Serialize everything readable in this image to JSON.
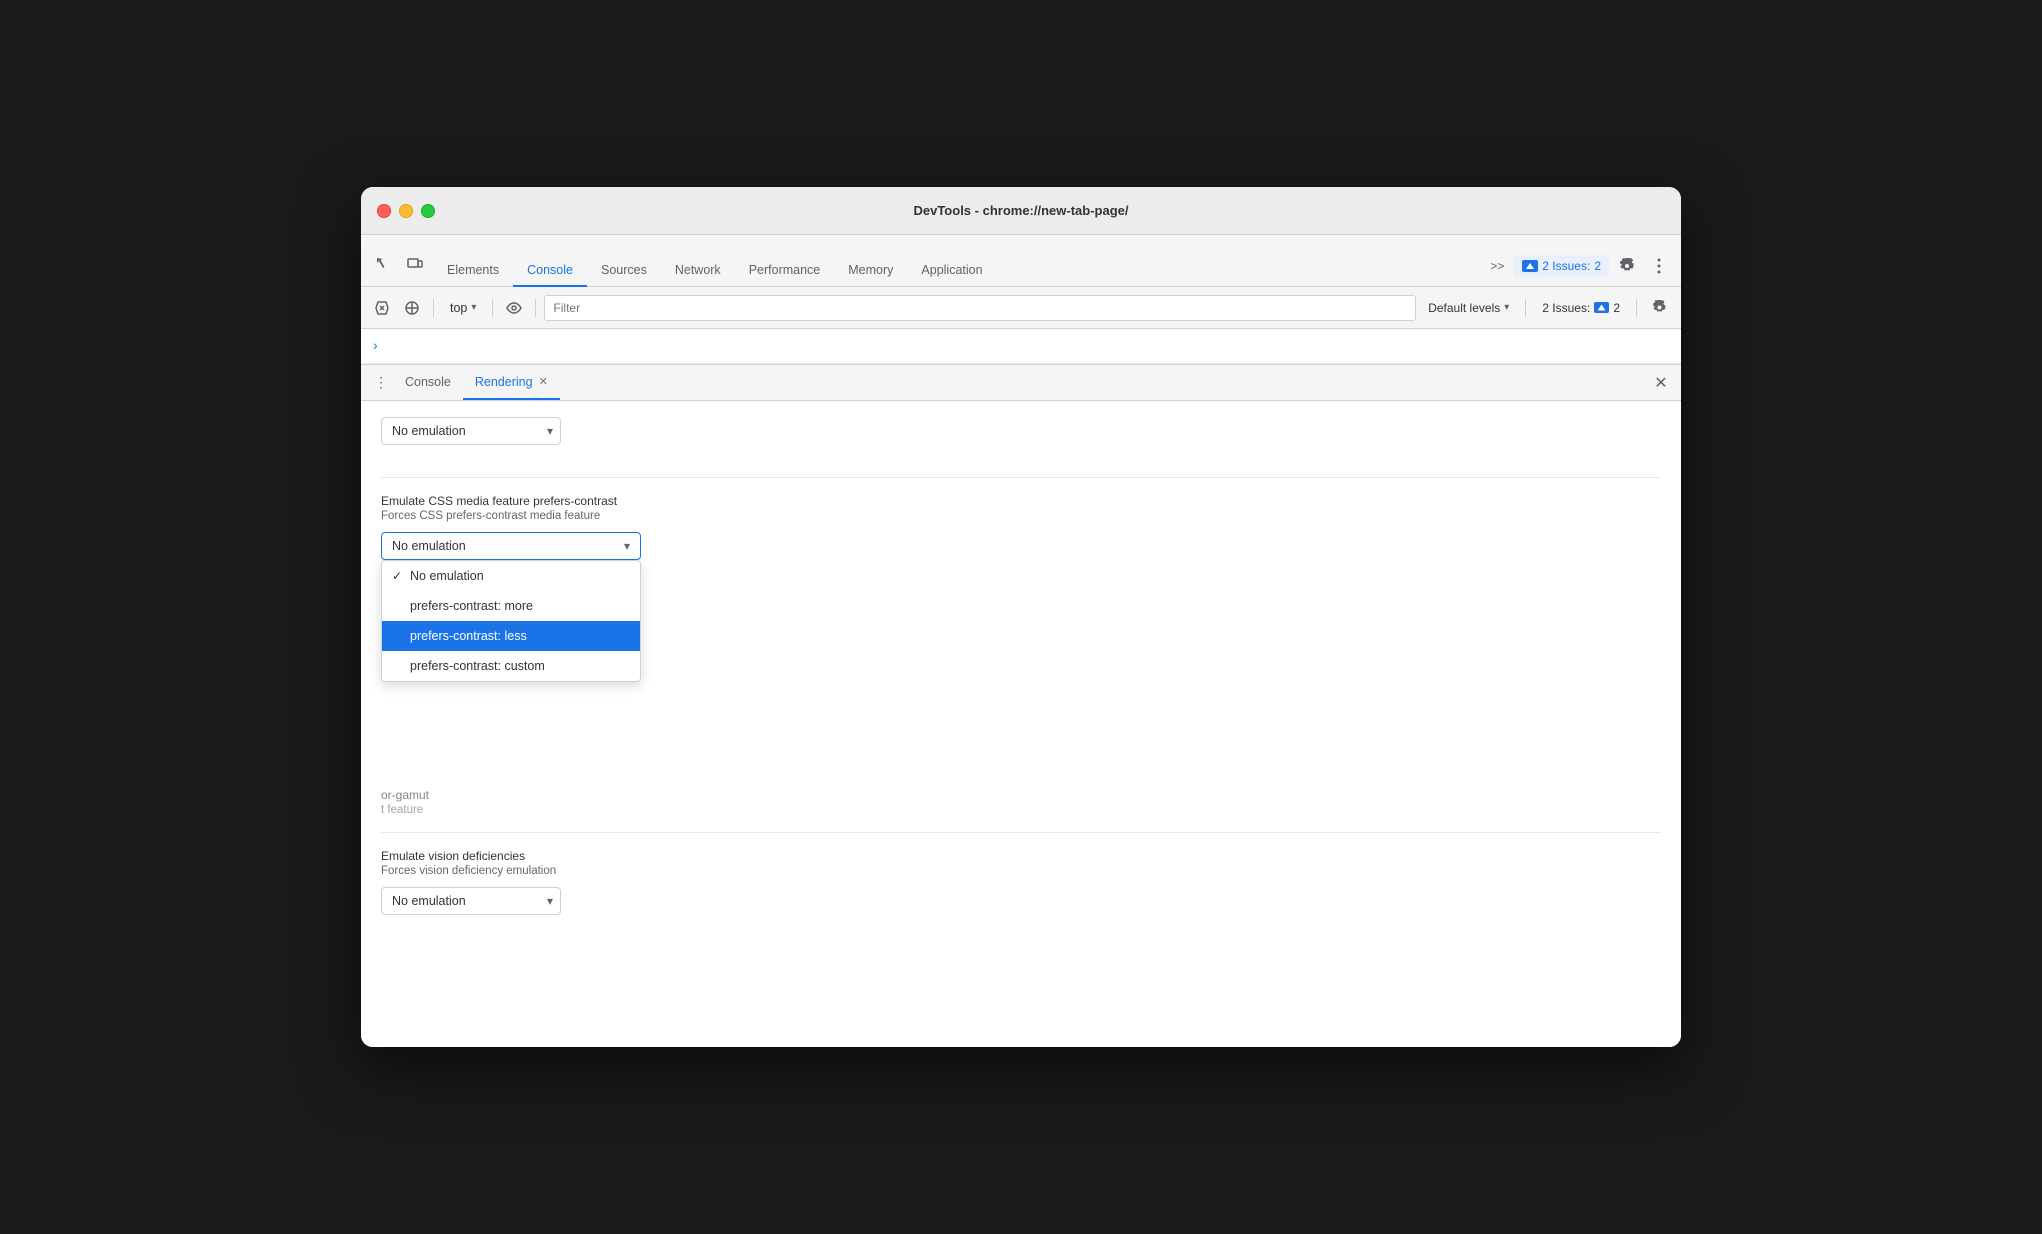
{
  "window": {
    "title": "DevTools - chrome://new-tab-page/"
  },
  "tabs": {
    "items": [
      {
        "id": "elements",
        "label": "Elements",
        "active": false
      },
      {
        "id": "console",
        "label": "Console",
        "active": true
      },
      {
        "id": "sources",
        "label": "Sources",
        "active": false
      },
      {
        "id": "network",
        "label": "Network",
        "active": false
      },
      {
        "id": "performance",
        "label": "Performance",
        "active": false
      },
      {
        "id": "memory",
        "label": "Memory",
        "active": false
      },
      {
        "id": "application",
        "label": "Application",
        "active": false
      }
    ],
    "more_label": ">>",
    "issues_label": "2",
    "issues_count_label": "2 Issues:"
  },
  "console_toolbar": {
    "context_label": "top",
    "filter_placeholder": "Filter",
    "levels_label": "Default levels",
    "issues_count": "2 Issues:",
    "issues_num": "2"
  },
  "drawer": {
    "tabs": [
      {
        "id": "console-tab",
        "label": "Console",
        "active": false,
        "closeable": false
      },
      {
        "id": "rendering-tab",
        "label": "Rendering",
        "active": true,
        "closeable": true
      }
    ]
  },
  "rendering": {
    "section1": {
      "dropdown_label": "No emulation",
      "value": "No emulation"
    },
    "section2": {
      "label": "Emulate CSS media feature prefers-contrast",
      "sublabel": "Forces CSS prefers-contrast media feature",
      "dropdown_current": "No emulation",
      "dropdown_options": [
        {
          "id": "no-emulation",
          "label": "No emulation",
          "selected": true,
          "checked": true
        },
        {
          "id": "prefers-more",
          "label": "prefers-contrast: more",
          "selected": false
        },
        {
          "id": "prefers-less",
          "label": "prefers-contrast: less",
          "selected": false,
          "highlighted": true
        },
        {
          "id": "prefers-custom",
          "label": "prefers-contrast: custom",
          "selected": false
        }
      ]
    },
    "section3": {
      "label_partial": "or-gamut",
      "sublabel_partial": "t feature"
    },
    "section4": {
      "label": "Emulate vision deficiencies",
      "sublabel": "Forces vision deficiency emulation",
      "dropdown_label": "No emulation"
    }
  }
}
